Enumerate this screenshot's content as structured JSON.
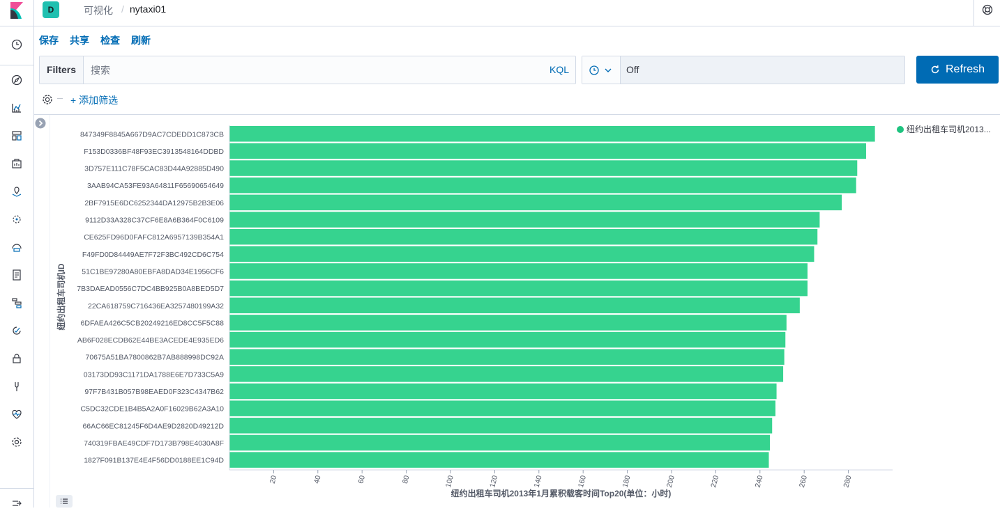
{
  "header": {
    "space_initial": "D",
    "breadcrumb_parent": "可视化",
    "breadcrumb_current": "nytaxi01"
  },
  "menu": {
    "save": "保存",
    "share": "共享",
    "inspect": "检查",
    "refresh": "刷新"
  },
  "query_bar": {
    "filters_label": "Filters",
    "search_placeholder": "搜索",
    "language": "KQL",
    "refresh_interval": "Off",
    "refresh_button": "Refresh"
  },
  "filter_bar": {
    "add_filter": "+ 添加筛选"
  },
  "sidebar": {
    "icons": [
      "clock-icon",
      "compass-icon",
      "visualize-icon",
      "dashboard-icon",
      "canvas-icon",
      "maps-icon",
      "ml-icon",
      "infrastructure-icon",
      "logs-icon",
      "apm-icon",
      "uptime-icon",
      "siem-icon",
      "dev-tools-icon",
      "monitoring-icon",
      "management-icon",
      "collapse-nav-icon"
    ]
  },
  "colors": {
    "bar": "#36d38f",
    "legend_dot": "#1ec37f",
    "accent": "#006bb4"
  },
  "chart_data": {
    "type": "bar",
    "orientation": "horizontal",
    "title": "",
    "xlabel": "纽约出租车司机2013年1月累积载客时间Top20(单位：小时)",
    "ylabel": "纽约出租车司机ID",
    "xlim": [
      0,
      300
    ],
    "xticks": [
      20,
      40,
      60,
      80,
      100,
      120,
      140,
      160,
      180,
      200,
      220,
      240,
      260,
      280
    ],
    "legend": "top-right",
    "grid": false,
    "categories": [
      "847349F8845A667D9AC7CDEDD1C873CB",
      "F153D0336BF48F93EC3913548164DDBD",
      "3D757E111C78F5CAC83D44A92885D490",
      "3AAB94CA53FE93A64811F65690654649",
      "2BF7915E6DC6252344DA12975B2B3E06",
      "9112D33A328C37CF6E8A6B364F0C6109",
      "CE625FD96D0FAFC812A6957139B354A1",
      "F49FD0D84449AE7F72F3BC492CD6C754",
      "51C1BE97280A80EBFA8DAD34E1956CF6",
      "7B3DAEAD0556C7DC4BB925B0A8BED5D7",
      "22CA618759C716436EA3257480199A32",
      "6DFAEA426C5CB20249216ED8CC5F5C88",
      "AB6F028ECDB62E44BE3ACEDE4E935ED6",
      "70675A51BA7800862B7AB888998DC92A",
      "03173DD93C1171DA1788E6E7D733C5A9",
      "97F7B431B057B98EAED0F323C4347B62",
      "C5DC32CDE1B4B5A2A0F16029B62A3A10",
      "66AC66EC81245F6D4AE9D2820D49212D",
      "740319FBAE49CDF7D173B798E4030A8F",
      "1827F091B137E4E4F56DD0188EE1C94D"
    ],
    "series": [
      {
        "name": "纽约出租车司机2013...",
        "values": [
          292,
          288,
          284,
          283.5,
          277,
          267,
          266,
          264.5,
          261.5,
          261.5,
          258,
          252,
          251.5,
          251,
          250.5,
          247.5,
          247,
          245.5,
          244.5,
          244
        ]
      }
    ]
  }
}
